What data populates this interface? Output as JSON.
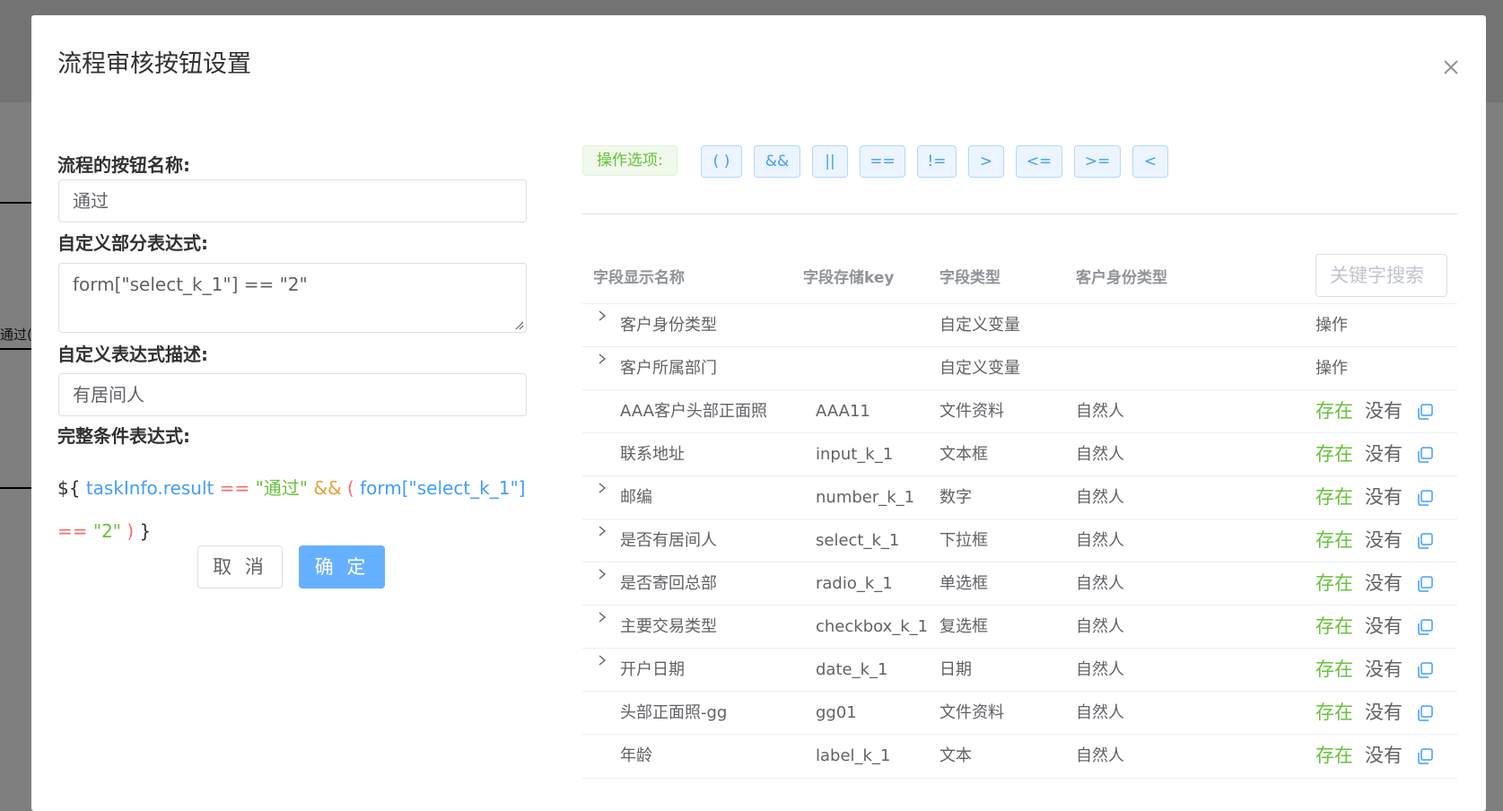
{
  "background": {
    "fragment": "通过(有"
  },
  "dialog": {
    "title": "流程审核按钮设置"
  },
  "form": {
    "button_name_label": "流程的按钮名称:",
    "button_name_value": "通过",
    "custom_expr_label": "自定义部分表达式:",
    "custom_expr_value": "form[\"select_k_1\"] == \"2\"",
    "expr_desc_label": "自定义表达式描述:",
    "expr_desc_value": "有居间人",
    "full_expr_label": "完整条件表达式:",
    "full_expr": {
      "t1": "${",
      "t2": "taskInfo.result",
      "t3": "==",
      "t4": "\"通过\"",
      "t5": "&&",
      "t6": "(",
      "t7": "form[\"select_k_1\"]",
      "t8": "==",
      "t9": "\"2\"",
      "t10": ")",
      "t11": "}"
    },
    "cancel_label": "取 消",
    "ok_label": "确 定"
  },
  "operators": {
    "label": "操作选项:",
    "items": [
      "( )",
      "&&",
      "||",
      "==",
      "!=",
      ">",
      "<=",
      ">=",
      "<"
    ]
  },
  "table": {
    "headers": [
      "字段显示名称",
      "字段存储key",
      "字段类型",
      "客户身份类型"
    ],
    "search_placeholder": "关键字搜索",
    "rows": [
      {
        "name": "客户身份类型",
        "key": "",
        "type": "自定义变量",
        "identity": "",
        "action": "操作"
      },
      {
        "name": "客户所属部门",
        "key": "",
        "type": "自定义变量",
        "identity": "",
        "action": "操作"
      },
      {
        "name": "AAA客户头部正面照",
        "key": "AAA11",
        "type": "文件资料",
        "identity": "自然人",
        "exist": "存在",
        "none": "没有"
      },
      {
        "name": "联系地址",
        "key": "input_k_1",
        "type": "文本框",
        "identity": "自然人",
        "exist": "存在",
        "none": "没有"
      },
      {
        "name": "邮编",
        "key": "number_k_1",
        "type": "数字",
        "identity": "自然人",
        "exist": "存在",
        "none": "没有"
      },
      {
        "name": "是否有居间人",
        "key": "select_k_1",
        "type": "下拉框",
        "identity": "自然人",
        "exist": "存在",
        "none": "没有"
      },
      {
        "name": "是否寄回总部",
        "key": "radio_k_1",
        "type": "单选框",
        "identity": "自然人",
        "exist": "存在",
        "none": "没有"
      },
      {
        "name": "主要交易类型",
        "key": "checkbox_k_1",
        "type": "复选框",
        "identity": "自然人",
        "exist": "存在",
        "none": "没有"
      },
      {
        "name": "开户日期",
        "key": "date_k_1",
        "type": "日期",
        "identity": "自然人",
        "exist": "存在",
        "none": "没有"
      },
      {
        "name": "头部正面照-gg",
        "key": "gg01",
        "type": "文件资料",
        "identity": "自然人",
        "exist": "存在",
        "none": "没有"
      },
      {
        "name": "年龄",
        "key": "label_k_1",
        "type": "文本",
        "identity": "自然人",
        "exist": "存在",
        "none": "没有"
      }
    ]
  },
  "colors": {
    "primary": "#409eff",
    "success": "#67c23a",
    "danger": "#f56c6c",
    "warning": "#e6a23c"
  }
}
